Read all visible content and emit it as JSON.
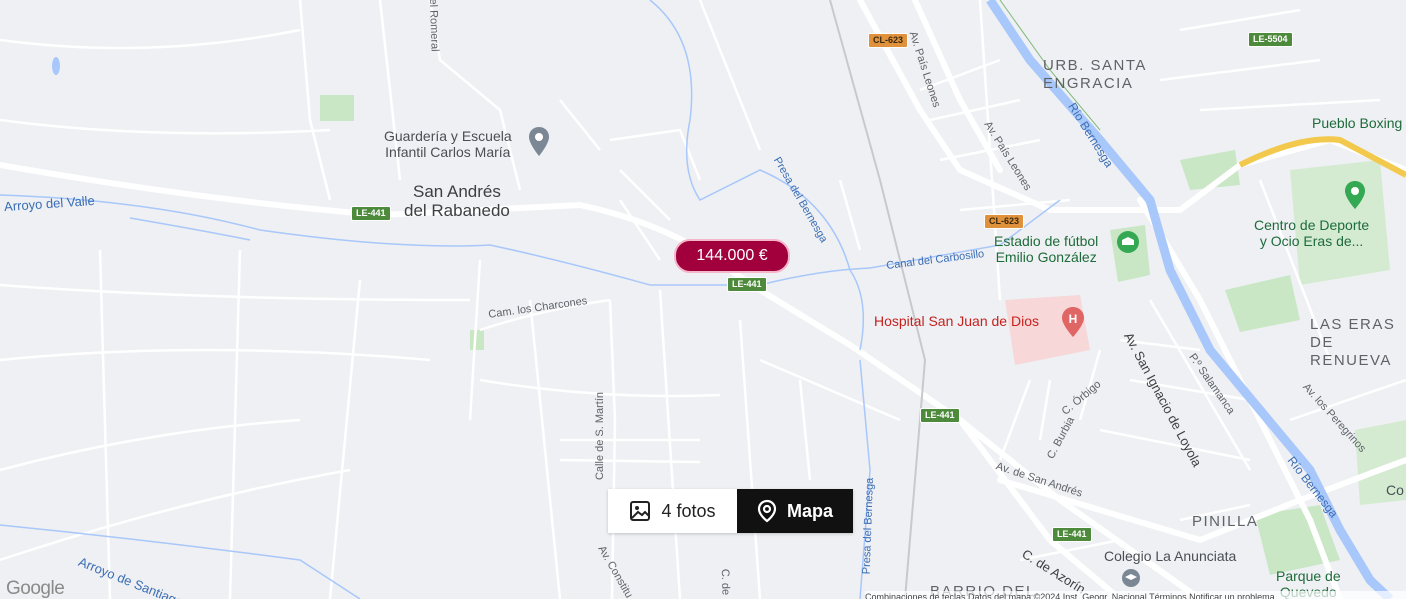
{
  "map": {
    "price_label": "144.000 €",
    "controls": {
      "photos_label": "4 fotos",
      "map_label": "Mapa"
    },
    "google_logo": "Google",
    "attribution": "Combinaciones de teclas   Datos del mapa ©2024 Inst. Geogr. Nacional   Términos   Notificar un problema",
    "places": {
      "san_andres": "San Andrés\ndel Rabanedo",
      "urb_santa_engracia": "URB. SANTA\nENGRACIA",
      "las_eras": "LAS ERAS DE\nRENUEVA",
      "pinilla": "PINILLA",
      "barrio_del": "BARRIO DEL"
    },
    "pois": {
      "guarderia": "Guardería y Escuela\nInfantil Carlos María",
      "estadio": "Estadio de fútbol\nEmilio González",
      "hospital": "Hospital San Juan de Dios",
      "centro_deporte": "Centro de Deporte\ny Ocio Eras de...",
      "pueblo_boxing": "Pueblo Boxing",
      "colegio": "Colegio La Anunciata",
      "parque": "Parque de\nQuevedo",
      "co": "Co"
    },
    "streets": {
      "arroyo_valle": "Arroyo del Valle",
      "arroyo_santiago": "Arroyo de Santiago",
      "cam_charcones": "Cam. los Charcones",
      "calle_martin": "Calle de S. Martín",
      "presa_bernesga_1": "Presa del Bernesga",
      "presa_bernesga_2": "Presa del Bernesga",
      "canal_carbosillo": "Canal del Carbosillo",
      "rio_bernesga_1": "Río Bernesga",
      "rio_bernesga_2": "Río Bernesga",
      "av_san_ignacio": "Av. San Ignacio de Loyola",
      "av_san_andres": "Av. de San Andrés",
      "c_orbigo": "C. Órbigo",
      "c_burbia": "C. Burbia",
      "p_salamanca": "P.º Salamanca",
      "av_peregrinos": "Av. los Peregrinos",
      "av_pais_leones_1": "Av. País Leones",
      "av_pais_leones_2": "Av. País Leones",
      "c_azorin": "C. de Azorín",
      "av_constitucion": "Av. Constitu",
      "del_romeral": "del Romeral",
      "c_de": "C. de"
    },
    "shields": {
      "le441_a": "LE-441",
      "le441_b": "LE-441",
      "le441_c": "LE-441",
      "le441_d": "LE-441",
      "cl623_a": "CL-623",
      "cl623_b": "CL-623",
      "le5504": "LE-5504"
    },
    "colors": {
      "price_pin": "#a1003d",
      "map_button": "#111111",
      "river": "#a8c7fa",
      "park": "#c8e6c9"
    }
  }
}
